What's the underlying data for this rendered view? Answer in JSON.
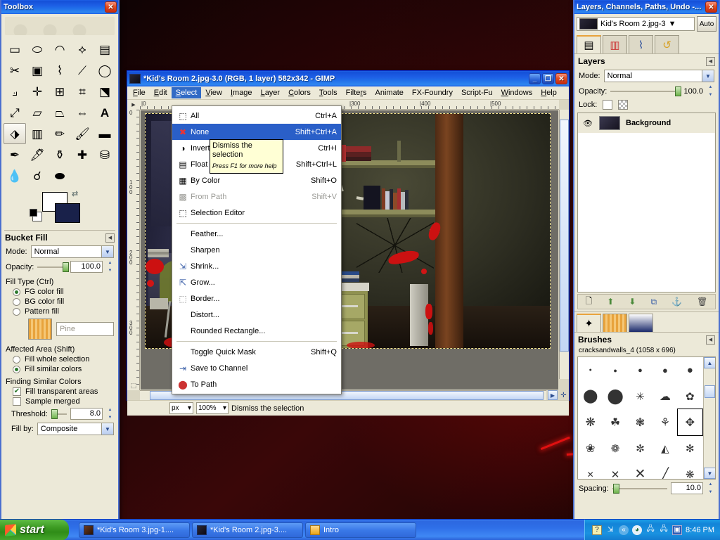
{
  "desktop": {
    "wallpaper_desc": "dark red cracked wall"
  },
  "toolbox": {
    "title": "Toolbox",
    "close_label": "✕",
    "tools": [
      {
        "name": "rect-select-tool",
        "glyph": "▭"
      },
      {
        "name": "ellipse-select-tool",
        "glyph": "⬭"
      },
      {
        "name": "free-select-tool",
        "glyph": "◠"
      },
      {
        "name": "fuzzy-select-tool",
        "glyph": "✨"
      },
      {
        "name": "select-by-color-tool",
        "glyph": "▤"
      },
      {
        "name": "scissors-select-tool",
        "glyph": "✂"
      },
      {
        "name": "foreground-select-tool",
        "glyph": "▣"
      },
      {
        "name": "paths-tool",
        "glyph": "✎"
      },
      {
        "name": "color-picker-tool",
        "glyph": "⟋"
      },
      {
        "name": "zoom-tool",
        "glyph": "🔍"
      },
      {
        "name": "measure-tool",
        "glyph": "⟂"
      },
      {
        "name": "move-tool",
        "glyph": "✛"
      },
      {
        "name": "alignment-tool",
        "glyph": "⊞"
      },
      {
        "name": "crop-tool",
        "glyph": "⌗"
      },
      {
        "name": "rotate-tool",
        "glyph": "⟳"
      },
      {
        "name": "scale-tool",
        "glyph": "⤢"
      },
      {
        "name": "shear-tool",
        "glyph": "▱"
      },
      {
        "name": "perspective-tool",
        "glyph": "⏢"
      },
      {
        "name": "flip-tool",
        "glyph": "⇔"
      },
      {
        "name": "text-tool",
        "glyph": "A"
      },
      {
        "name": "bucket-fill-tool",
        "glyph": "⬗",
        "selected": true
      },
      {
        "name": "blend-tool",
        "glyph": "▥"
      },
      {
        "name": "pencil-tool",
        "glyph": "✏"
      },
      {
        "name": "paintbrush-tool",
        "glyph": "🖌"
      },
      {
        "name": "eraser-tool",
        "glyph": "▬"
      },
      {
        "name": "airbrush-tool",
        "glyph": "✒"
      },
      {
        "name": "ink-tool",
        "glyph": "🖋"
      },
      {
        "name": "clone-tool",
        "glyph": "⚱"
      },
      {
        "name": "heal-tool",
        "glyph": "✚"
      },
      {
        "name": "perspective-clone-tool",
        "glyph": "⛁"
      },
      {
        "name": "blur-sharpen-tool",
        "glyph": "💧"
      },
      {
        "name": "smudge-tool",
        "glyph": "☌"
      },
      {
        "name": "dodge-burn-tool",
        "glyph": "🍳"
      }
    ],
    "fg_color": "#ffffff",
    "bg_color": "#19214a",
    "swap_icon": "⇄"
  },
  "tool_options": {
    "title": "Bucket Fill",
    "collapse_icon": "◀",
    "mode_label": "Mode:",
    "mode_value": "Normal",
    "opacity_label": "Opacity:",
    "opacity_value": "100.0",
    "fill_type_label": "Fill Type  (Ctrl)",
    "fill_types": [
      {
        "label": "FG color fill",
        "selected": true
      },
      {
        "label": "BG color fill",
        "selected": false
      },
      {
        "label": "Pattern fill",
        "selected": false
      }
    ],
    "pattern_name": "Pine",
    "affected_area_label": "Affected Area  (Shift)",
    "affected_areas": [
      {
        "label": "Fill whole selection",
        "selected": false
      },
      {
        "label": "Fill similar colors",
        "selected": true
      }
    ],
    "finding_label": "Finding Similar Colors",
    "checkboxes": [
      {
        "label": "Fill transparent areas",
        "checked": true
      },
      {
        "label": "Sample merged",
        "checked": false
      }
    ],
    "threshold_label": "Threshold:",
    "threshold_value": "8.0",
    "fill_by_label": "Fill by:",
    "fill_by_value": "Composite"
  },
  "image_window": {
    "title": "*Kid's Room 2.jpg-3.0 (RGB, 1 layer) 582x342 - GIMP",
    "minimize_label": "_",
    "maximize_label": "❐",
    "close_label": "✕",
    "menus": [
      {
        "label": "File",
        "mnemonic": "F",
        "active": false
      },
      {
        "label": "Edit",
        "mnemonic": "E",
        "active": false
      },
      {
        "label": "Select",
        "mnemonic": "S",
        "active": true
      },
      {
        "label": "View",
        "mnemonic": "V",
        "active": false
      },
      {
        "label": "Image",
        "mnemonic": "I",
        "active": false
      },
      {
        "label": "Layer",
        "mnemonic": "L",
        "active": false
      },
      {
        "label": "Colors",
        "mnemonic": "C",
        "active": false
      },
      {
        "label": "Tools",
        "mnemonic": "T",
        "active": false
      },
      {
        "label": "Filters",
        "mnemonic": "r",
        "active": false
      },
      {
        "label": "Animate",
        "mnemonic": "",
        "active": false
      },
      {
        "label": "FX-Foundry",
        "mnemonic": "",
        "active": false
      },
      {
        "label": "Script-Fu",
        "mnemonic": "",
        "active": false
      },
      {
        "label": "Windows",
        "mnemonic": "W",
        "active": false
      },
      {
        "label": "Help",
        "mnemonic": "H",
        "active": false
      }
    ],
    "ruler_h_ticks": [
      "0",
      "300",
      "400",
      "500"
    ],
    "ruler_v_ticks": [
      "0",
      "100",
      "200",
      "300"
    ],
    "status": {
      "unit": "px",
      "zoom": "100%",
      "message": "Dismiss the selection"
    }
  },
  "select_menu": {
    "items": [
      {
        "label": "All",
        "accel": "Ctrl+A",
        "icon": "⬚",
        "state": "normal"
      },
      {
        "label": "None",
        "accel": "Shift+Ctrl+A",
        "icon": "✖",
        "state": "highlighted"
      },
      {
        "label": "Invert",
        "accel": "Ctrl+I",
        "icon": "◑",
        "state": "normal"
      },
      {
        "label": "Float",
        "accel": "Shift+Ctrl+L",
        "icon": "▤",
        "state": "normal"
      },
      {
        "label": "By Color",
        "accel": "Shift+O",
        "icon": "▦",
        "state": "normal"
      },
      {
        "label": "From Path",
        "accel": "Shift+V",
        "icon": "▩",
        "state": "disabled"
      },
      {
        "label": "Selection Editor",
        "accel": "",
        "icon": "⬚",
        "state": "normal"
      },
      {
        "separator": true
      },
      {
        "label": "Feather...",
        "accel": "",
        "icon": "",
        "state": "normal"
      },
      {
        "label": "Sharpen",
        "accel": "",
        "icon": "",
        "state": "normal"
      },
      {
        "label": "Shrink...",
        "accel": "",
        "icon": "⇲",
        "state": "normal"
      },
      {
        "label": "Grow...",
        "accel": "",
        "icon": "⇱",
        "state": "normal"
      },
      {
        "label": "Border...",
        "accel": "",
        "icon": "⬚",
        "state": "normal"
      },
      {
        "label": "Distort...",
        "accel": "",
        "icon": "",
        "state": "normal"
      },
      {
        "label": "Rounded Rectangle...",
        "accel": "",
        "icon": "",
        "state": "normal"
      },
      {
        "separator": true
      },
      {
        "label": "Toggle Quick Mask",
        "accel": "Shift+Q",
        "icon": "",
        "state": "normal"
      },
      {
        "label": "Save to Channel",
        "accel": "",
        "icon": "⇥",
        "state": "normal"
      },
      {
        "label": "To Path",
        "accel": "",
        "icon": "⬤",
        "state": "normal"
      }
    ]
  },
  "tooltip": {
    "title": "Dismiss the selection",
    "hint": "Press F1 for more help"
  },
  "dock": {
    "title": "Layers, Channels, Paths, Undo -...",
    "close_label": "✕",
    "image_name": "Kid's Room 2.jpg-3",
    "auto_label": "Auto",
    "dropdown_icon": "⌄",
    "tabs": [
      {
        "name": "layers-tab",
        "glyph": "▤",
        "active": true
      },
      {
        "name": "channels-tab",
        "glyph": "▦",
        "active": false
      },
      {
        "name": "paths-tab",
        "glyph": "✎",
        "active": false
      },
      {
        "name": "undo-history-tab",
        "glyph": "↺",
        "active": false
      }
    ],
    "layers": {
      "panel_title": "Layers",
      "collapse_icon": "◀",
      "mode_label": "Mode:",
      "mode_value": "Normal",
      "opacity_label": "Opacity:",
      "opacity_value": "100.0",
      "lock_label": "Lock:",
      "items": [
        {
          "name": "Background",
          "visible": true,
          "eye": "👁"
        }
      ],
      "buttons": [
        {
          "name": "new-layer-button",
          "glyph": "🗋"
        },
        {
          "name": "raise-layer-button",
          "glyph": "⬆"
        },
        {
          "name": "lower-layer-button",
          "glyph": "⬇"
        },
        {
          "name": "duplicate-layer-button",
          "glyph": "⧉"
        },
        {
          "name": "anchor-layer-button",
          "glyph": "⚓"
        },
        {
          "name": "delete-layer-button",
          "glyph": "🗑"
        }
      ]
    },
    "brushes": {
      "tabs": [
        {
          "name": "brushes-tab",
          "glyph": "✦",
          "active": true
        },
        {
          "name": "patterns-tab",
          "glyph": "▥",
          "active": false
        },
        {
          "name": "gradients-tab",
          "glyph": "▨",
          "active": false
        }
      ],
      "panel_title": "Brushes",
      "collapse_icon": "◀",
      "selected_brush": "cracksandwalls_4 (1058 x 696)",
      "spacing_label": "Spacing:",
      "spacing_value": "10.0",
      "cells": [
        "•",
        "•",
        "●",
        "●",
        "●",
        "⬤",
        "⬤",
        "✳",
        "☁",
        "✿",
        "❋",
        "☘",
        "❃",
        "⚘",
        "✥",
        "❀",
        "❁",
        "✼",
        "◭",
        "✻",
        "✕",
        "✕",
        "✕",
        "╱",
        "❋"
      ]
    }
  },
  "taskbar": {
    "start_label": "start",
    "tasks": [
      {
        "label": "*Kid's Room 3.jpg-1....",
        "icon_color": "#3a2418"
      },
      {
        "label": "*Kid's Room 2.jpg-3....",
        "icon_color": "#1a1830"
      },
      {
        "label": "Intro",
        "icon_color": "#f0c04a"
      }
    ],
    "tray": {
      "icons": [
        "?",
        "⇅",
        "«",
        "◕",
        "🖧",
        "🖧",
        "🗔"
      ],
      "clock": "8:46 PM"
    }
  }
}
